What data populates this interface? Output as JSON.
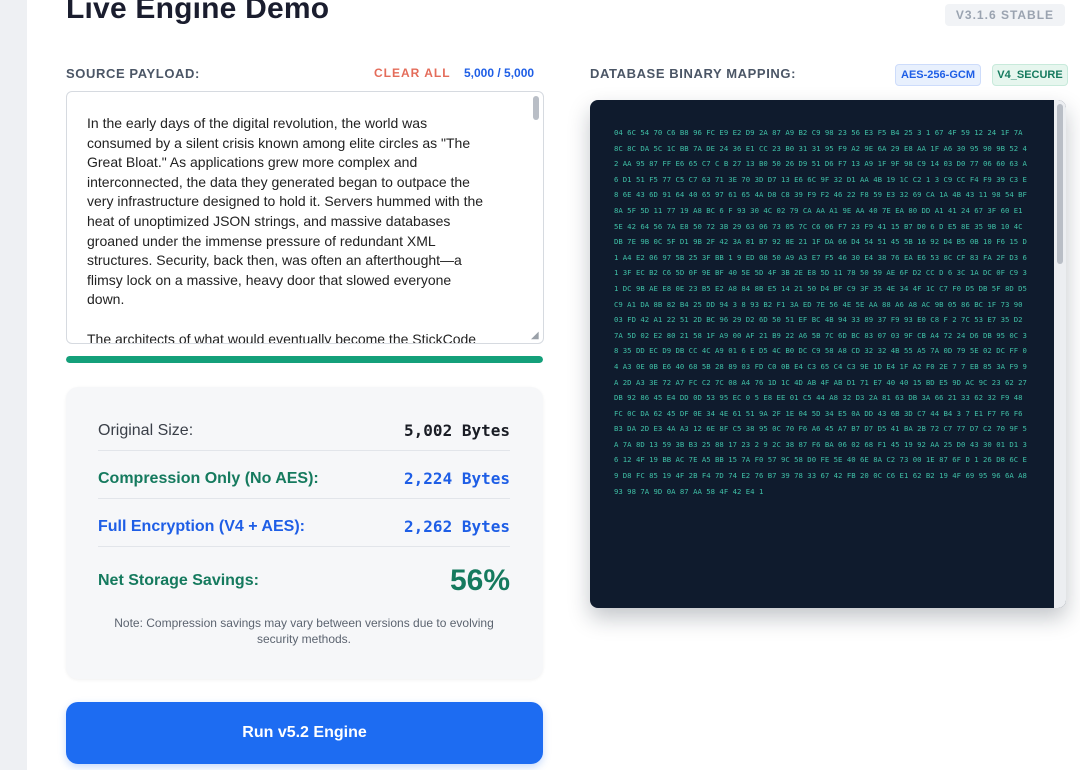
{
  "app": {
    "title": "Live Engine Demo",
    "version": "V3.1.6 STABLE"
  },
  "source": {
    "label": "SOURCE PAYLOAD:",
    "clear_label": "CLEAR ALL",
    "counter": "5,000 / 5,000",
    "progress_fraction": 1.0,
    "text": "In the early days of the digital revolution, the world was\nconsumed by a silent crisis known among elite circles as \"The\nGreat Bloat.\" As applications grew more complex and\ninterconnected, the data they generated began to outpace the\nvery infrastructure designed to hold it. Servers hummed with the\nheat of unoptimized JSON strings, and massive databases\ngroaned under the immense pressure of redundant XML\nstructures. Security, back then, was often an afterthought—a\nflimsy lock on a massive, heavy door that slowed everyone\ndown.\n\nThe architects of what would eventually become the StickCode"
  },
  "stats": {
    "original_label": "Original Size:",
    "original_value": "5,002 Bytes",
    "compression_label": "Compression Only (No AES):",
    "compression_value": "2,224 Bytes",
    "encryption_label": "Full Encryption (V4 + AES):",
    "encryption_value": "2,262 Bytes",
    "savings_label": "Net Storage Savings:",
    "savings_value": "56%",
    "note": "Note: Compression savings may vary between versions due to evolving security methods."
  },
  "action": {
    "run_label": "Run v5.2 Engine"
  },
  "database": {
    "label": "DATABASE BINARY MAPPING:",
    "tag_cipher": "AES-256-GCM",
    "tag_version": "V4_SECURE",
    "hex": "04 6C 54 70 C6 B8 96 FC E9 E2 D9 2A 87 A9 B2 C9 98 23 56 E3 F5 B4 25 3 1 67 4F 59 12 24 1F 7A 8C 8C DA 5C 1C BB 7A DE 24 36 E1 CC 23 B0 31 31 95 F9 A2 9E 6A 29 E8 AA 1F A6 30 95 90 9B 52 42 AA 95 87 FF E6 65 C7 C B 27 13 B0 50 26 D9 51 D6 F7 13 A9 1F 9F 98 C9 14 03 D0 77 06 60 63 A6 D1 51 F5 77 C5 C7 63 71 3E 70 3D D7 13 E6 6C 9F 32 D1 AA 4B 19 1C C2 1 3 C9 CC F4 F9 39 C3 E8 6E 43 6D 91 64 40 65 97 61 65 4A D8 C8 39 F9 F2 46 22 F8 59 E3 32 69 CA 1A 4B 43 11 98 54 BF 8A 5F 5D 11 77 19 A8 BC 6 F 93 30 4C 02 79 CA AA A1 9E AA 40 7E EA 80 DD A1 41 24 67 3F 60 E1 5E 42 64 56 7A E8 50 72 3B 29 63 06 73 05 7C C6 06 F7 23 F9 41 15 B7 D0 6 D E5 8E 35 9B 10 4C DB 7E 9B 0C 5F D1 9B 2F 42 3A 81 B7 92 8E 21 1F DA 66 D4 54 51 45 5B 16 92 D4 B5 0B 10 F6 15 D1 A4 E2 06 97 5B 25 3F BB 1 9 ED 08 50 A9 A3 E7 F5 46 30 E4 38 76 EA E6 53 8C CF 83 FA 2F D3 61 3F EC B2 C6 5D 0F 9E BF 40 5E 5D 4F 3B 2E E8 5D 11 78 50 59 AE 6F D2 CC D 6 3C 1A DC 0F C9 31 DC 9B AE E8 0E 23 B5 E2 A8 84 8B E5 14 21 50 D4 BF C9 3F 35 4E 34 4F 1C C7 F0 D5 DB 5F 8D D5 C9 A1 DA 8B 82 B4 25 DD 94 3 8 93 B2 F1 3A ED 7E 56 4E 5E AA 88 A6 A8 AC 9B 05 86 BC 1F 73 90 03 FD 42 A1 22 51 2D BC 96 29 D2 6D 50 51 EF BC 4B 94 33 89 37 F9 93 E0 C8 F 2 7C 53 E7 35 D2 7A 5D 02 E2 80 21 58 1F A9 00 AF 21 B9 22 A6 5B 7C 6D BC 83 07 03 9F CB A4 72 24 D6 DB 95 0C 38 35 DD EC D9 DB CC 4C A9 01 6 E D5 4C B0 DC C9 58 A8 CD 32 32 4B 55 A5 7A 0D 79 5E 02 DC FF 04 A3 0E 0B E6 40 68 5B 28 89 03 FD C0 0B E4 C3 65 C4 C3 9E 1D E4 1F A2 F0 2E 7 7 EB 85 3A F9 9A 2D A3 3E 72 A7 FC C2 7C 08 A4 76 1D 1C 4D AB 4F AB D1 71 E7 40 40 15 BD E5 9D AC 9C 23 62 27 DB 92 86 45 E4 DD 0D 53 95 EC 0 5 E8 EE 01 C5 44 A8 32 D3 2A 81 63 DB 3A 66 21 33 62 32 F9 48 FC 0C DA 62 45 DF 0E 34 4E 61 51 9A 2F 1E 04 5D 34 E5 0A DD 43 6B 3D C7 44 B4 3 7 E1 F7 F6 F6 B3 DA 2D E3 4A A3 12 6E 8F C5 38 95 0C 70 F6 A6 45 A7 B7 D7 D5 41 BA 2B 72 C7 77 D7 C2 70 9F 5A 7A 8D 13 59 3B B3 25 88 17 23 2 9 2C 38 87 F6 BA 06 02 68 F1 45 19 92 AA 25 D0 43 30 01 D1 36 12 4F 19 BB AC 7E A5 BB 15 7A F0 57 9C 58 D0 FE 5E 40 6E 8A C2 73 00 1E 87 6F D 1 26 D8 6C E9 D8 FC 85 19 4F 2B F4 7D 74 E2 76 B7 39 78 33 67 42 FB 20 0C C6 E1 62 B2 19 4F 69 95 96 6A A8 93 98 7A 9D 0A 87 AA 58 4F 42 E4 1"
  },
  "colors": {
    "primary": "#1d6cf2",
    "success": "#157a5e",
    "danger": "#e46c5a",
    "hex_text": "#3fbfa6",
    "hex_bg": "#0f1b2d"
  }
}
